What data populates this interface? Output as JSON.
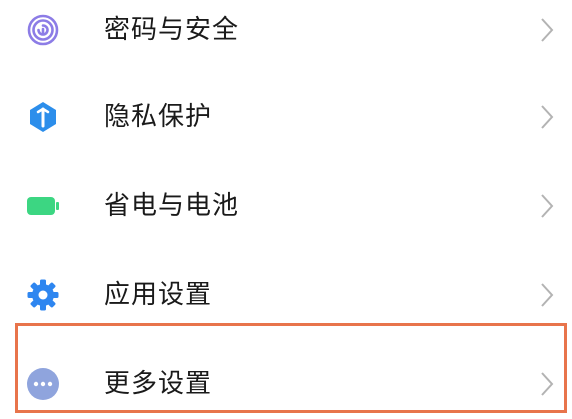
{
  "settings": {
    "items": [
      {
        "label": "密码与安全",
        "icon": "fingerprint-icon",
        "icon_color": "#8C7CE6"
      },
      {
        "label": "隐私保护",
        "icon": "shield-icon",
        "icon_color": "#2C8EEB"
      },
      {
        "label": "省电与电池",
        "icon": "battery-icon",
        "icon_color": "#3CD682"
      },
      {
        "label": "应用设置",
        "icon": "gear-icon",
        "icon_color": "#2E86F0"
      },
      {
        "label": "更多设置",
        "icon": "more-dots-icon",
        "icon_color": "#8FA4DD"
      }
    ],
    "chevron_icon": "chevron-right-icon",
    "chevron_color": "#B3B3B3",
    "highlight_color": "#E8744B",
    "highlighted_item": "更多设置"
  }
}
